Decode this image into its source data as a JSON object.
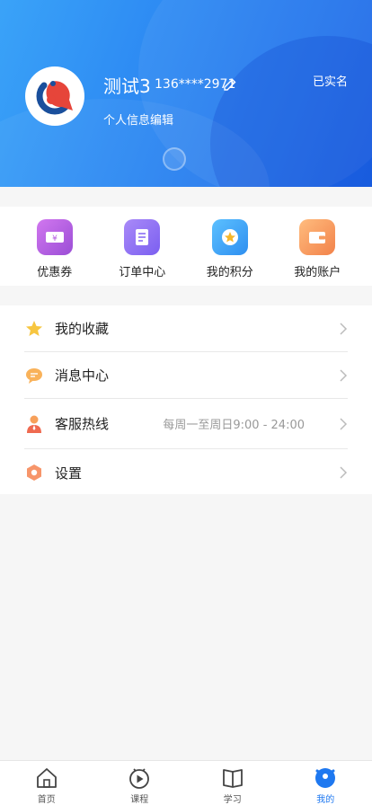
{
  "profile": {
    "name": "测试3",
    "phone": "136****2971",
    "edit_info": "个人信息编辑",
    "verified": "已实名"
  },
  "quick_actions": [
    {
      "label": "优惠券",
      "icon": "coupon-icon",
      "color": "#b55ce0"
    },
    {
      "label": "订单中心",
      "icon": "order-icon",
      "color": "#8b6ef3"
    },
    {
      "label": "我的积分",
      "icon": "points-icon",
      "color": "#3aa0f5"
    },
    {
      "label": "我的账户",
      "icon": "wallet-icon",
      "color": "#f79a5c"
    }
  ],
  "menu": [
    {
      "label": "我的收藏",
      "icon": "star-icon"
    },
    {
      "label": "消息中心",
      "icon": "message-icon"
    },
    {
      "label": "客服热线",
      "icon": "support-icon",
      "hint": "每周一至周日9:00 - 24:00"
    },
    {
      "label": "设置",
      "icon": "settings-icon"
    }
  ],
  "tabs": [
    {
      "label": "首页",
      "icon": "home-icon",
      "active": false
    },
    {
      "label": "课程",
      "icon": "course-icon",
      "active": false
    },
    {
      "label": "学习",
      "icon": "study-icon",
      "active": false
    },
    {
      "label": "我的",
      "icon": "profile-icon",
      "active": true
    }
  ],
  "colors": {
    "accent": "#1e78f0",
    "header_start": "#3aa3f8",
    "header_end": "#1d66e6"
  }
}
